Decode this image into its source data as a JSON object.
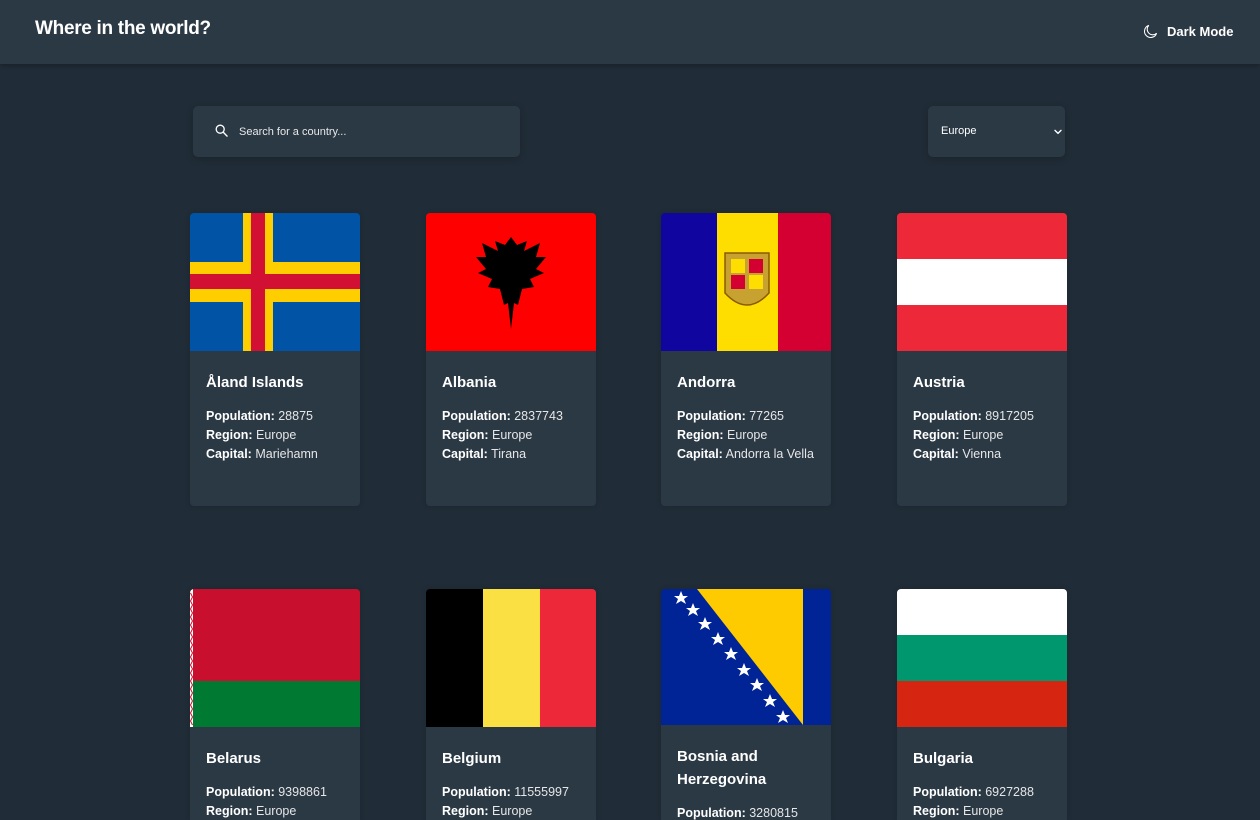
{
  "header": {
    "title": "Where in the world?",
    "mode_label": "Dark Mode",
    "mode_icon": "moon-icon"
  },
  "search": {
    "placeholder": "Search for a country...",
    "icon": "search-icon"
  },
  "filter": {
    "selected": "Europe",
    "icon": "chevron-down-icon"
  },
  "labels": {
    "population": "Population:",
    "region": "Region:",
    "capital": "Capital:"
  },
  "countries": [
    {
      "name": "Åland Islands",
      "population": "28875",
      "region": "Europe",
      "capital": "Mariehamn"
    },
    {
      "name": "Albania",
      "population": "2837743",
      "region": "Europe",
      "capital": "Tirana"
    },
    {
      "name": "Andorra",
      "population": "77265",
      "region": "Europe",
      "capital": "Andorra la Vella"
    },
    {
      "name": "Austria",
      "population": "8917205",
      "region": "Europe",
      "capital": "Vienna"
    },
    {
      "name": "Belarus",
      "population": "9398861",
      "region": "Europe"
    },
    {
      "name": "Belgium",
      "population": "11555997",
      "region": "Europe"
    },
    {
      "name": "Bosnia and Herzegovina",
      "population": "3280815"
    },
    {
      "name": "Bulgaria",
      "population": "6927288",
      "region": "Europe"
    }
  ],
  "colors": {
    "background": "#202c37",
    "surface": "#2b3945",
    "text": "#ffffff"
  }
}
